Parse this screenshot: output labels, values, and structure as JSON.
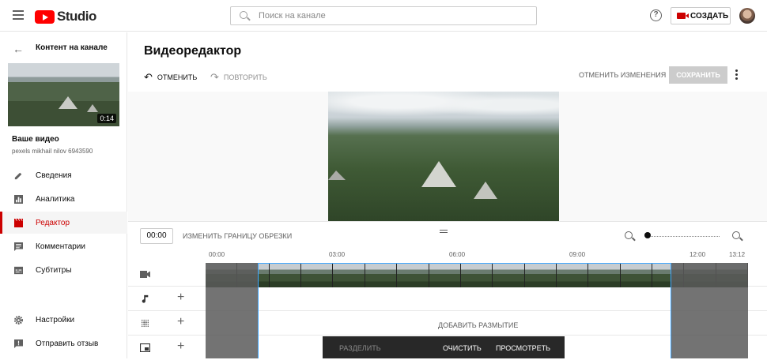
{
  "header": {
    "logo_text": "Studio",
    "search_placeholder": "Поиск на канале",
    "help_icon": "?",
    "create_label": "СОЗДАТЬ"
  },
  "sidebar": {
    "channel_label": "Контент на канале",
    "video_duration": "0:14",
    "video_title": "Ваше видео",
    "video_subtitle": "pexels mikhail nilov 6943590",
    "items": [
      {
        "label": "Сведения",
        "icon": "pencil-icon"
      },
      {
        "label": "Аналитика",
        "icon": "analytics-icon"
      },
      {
        "label": "Редактор",
        "icon": "clapper-icon",
        "active": true
      },
      {
        "label": "Комментарии",
        "icon": "comment-icon"
      },
      {
        "label": "Субтитры",
        "icon": "subtitles-icon"
      }
    ],
    "bottom_items": [
      {
        "label": "Настройки",
        "icon": "gear-icon"
      },
      {
        "label": "Отправить отзыв",
        "icon": "feedback-icon"
      }
    ]
  },
  "editor": {
    "title": "Видеоредактор",
    "undo_label": "ОТМЕНИТЬ",
    "redo_label": "ПОВТОРИТЬ",
    "discard_label": "ОТМЕНИТЬ ИЗМЕНЕНИЯ",
    "save_label": "СОХРАНИТЬ",
    "timecode": "00:00",
    "trim_label": "ИЗМЕНИТЬ ГРАНИЦУ ОБРЕЗКИ",
    "ruler_ticks": [
      "00:00",
      "03:00",
      "06:00",
      "09:00",
      "12:00",
      "13:12"
    ],
    "blur_label": "ДОБАВИТЬ РАЗМЫТИЕ",
    "actions": {
      "split_label": "РАЗДЕЛИТЬ",
      "clear_label": "ОЧИСТИТЬ",
      "preview_label": "ПРОСМОТРЕТЬ"
    }
  },
  "colors": {
    "accent": "#cc0000",
    "selection": "#3ea6ff",
    "save_disabled": "#cccccc"
  }
}
